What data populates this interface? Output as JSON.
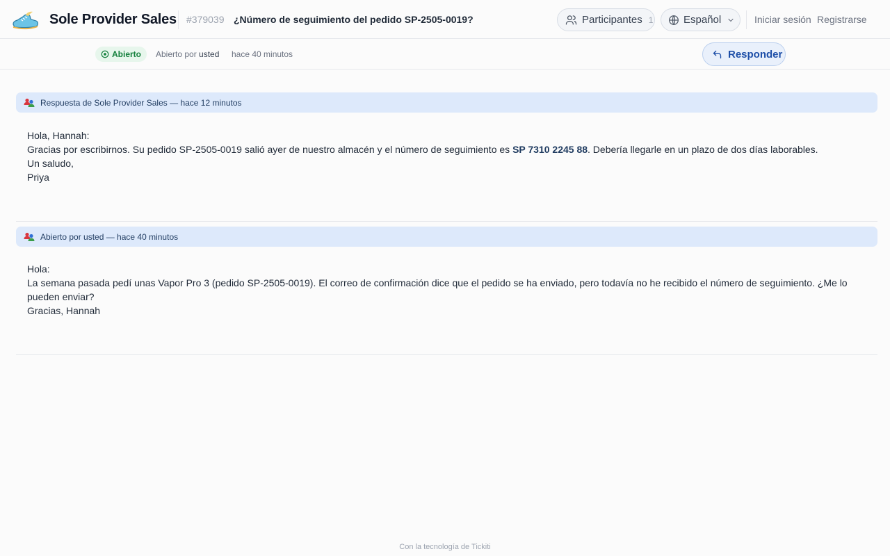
{
  "header": {
    "brand": "Sole Provider Sales",
    "ticket_id": "#379039",
    "ticket_title": "¿Número de seguimiento del pedido SP-2505-0019?",
    "participants_label": "Participantes",
    "participants_count": "1",
    "language_label": "Español",
    "login_label": "Iniciar sesión",
    "register_label": "Registrarse"
  },
  "subbar": {
    "status": "Abierto",
    "opened_by_prefix": "Abierto por",
    "opened_by_user": "usted",
    "opened_time": "hace 40 minutos",
    "reply_label": "Responder"
  },
  "messages": [
    {
      "header": "Respuesta de Sole Provider Sales — hace 12 minutos",
      "greeting": "Hola, Hannah:",
      "line1_before": "Gracias por escribirnos. Su pedido SP-2505-0019 salió ayer de nuestro almacén y el número de seguimiento es ",
      "tracking": "SP 7310 2245 88",
      "line1_after": ". Debería llegarle en un plazo de dos días laborables.",
      "closing": "Un saludo,",
      "signature": "Priya"
    },
    {
      "header": "Abierto por usted — hace 40 minutos",
      "greeting": "Hola:",
      "body": "La semana pasada pedí unas Vapor Pro 3 (pedido SP-2505-0019). El correo de confirmación dice que el pedido se ha enviado, pero todavía no he recibido el número de seguimiento. ¿Me lo pueden enviar?",
      "signature": "Gracias, Hannah"
    }
  ],
  "footer": "Con la tecnología de Tickiti",
  "colors": {
    "accent": "#1e4fa8",
    "status_green": "#15803d",
    "message_header_bg": "#dde9fb"
  },
  "icons": [
    "sneaker-logo-icon",
    "users-icon",
    "globe-icon",
    "chevron-down-icon",
    "status-circle-icon",
    "reply-arrow-icon",
    "people-group-icon"
  ]
}
